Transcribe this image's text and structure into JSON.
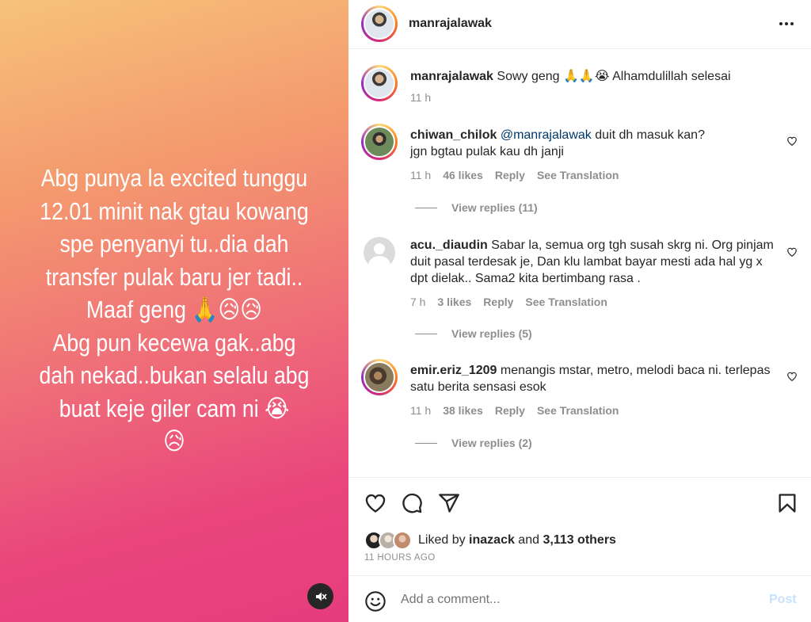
{
  "media": {
    "story_text": "Abg punya la excited tunggu\n12.01 minit nak gtau kowang\nspe penyanyi tu..dia dah\ntransfer pulak baru jer tadi..\nMaaf geng 🙏😥😥\nAbg pun kecewa gak..abg\ndah nekad..bukan selalu abg\nbuat keje giler cam ni 😭\n😥",
    "mute_icon": "speaker-muted-icon"
  },
  "header": {
    "username": "manrajalawak"
  },
  "caption": {
    "username": "manrajalawak",
    "text": " Sowy geng 🙏🙏😭 Alhamdulillah selesai",
    "time": "11 h"
  },
  "comments": [
    {
      "username": "chiwan_chilok",
      "mention": "@manrajalawak",
      "text_line1": " duit dh masuk kan?",
      "text_line2": "jgn bgtau pulak kau dh janji",
      "time": "11 h",
      "likes": "46 likes",
      "reply": "Reply",
      "translate": "See Translation",
      "view_replies": "View replies (11)"
    },
    {
      "username": "acu._diaudin",
      "text": " Sabar la, semua org tgh susah skrg ni. Org pinjam duit pasal terdesak je, Dan klu lambat bayar mesti ada hal yg x dpt dielak.. Sama2 kita bertimbang rasa .",
      "time": "7 h",
      "likes": "3 likes",
      "reply": "Reply",
      "translate": "See Translation",
      "view_replies": "View replies (5)"
    },
    {
      "username": "emir.eriz_1209",
      "text": " menangis mstar, metro, melodi baca ni. terlepas satu berita sensasi esok",
      "time": "11 h",
      "likes": "38 likes",
      "reply": "Reply",
      "translate": "See Translation",
      "view_replies": "View replies (2)"
    }
  ],
  "likes": {
    "prefix": "Liked by ",
    "user": "inazack",
    "middle": " and ",
    "others": "3,113 others"
  },
  "posted_time": "11 HOURS AGO",
  "add_comment": {
    "placeholder": "Add a comment...",
    "post_label": "Post"
  },
  "colors": {
    "link": "#00376b",
    "muted": "#8e8e8e",
    "post_disabled": "#c7e0fd"
  }
}
